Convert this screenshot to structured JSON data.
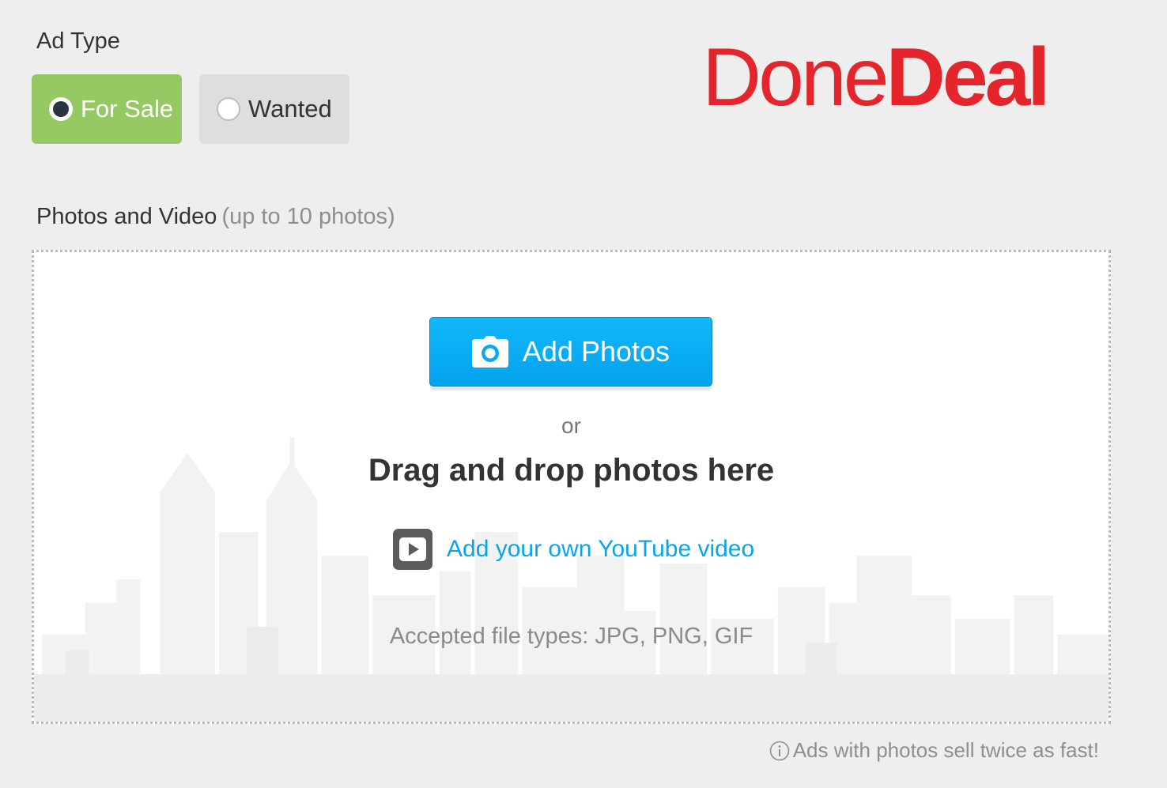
{
  "ad_type": {
    "label": "Ad Type",
    "options": [
      {
        "label": "For Sale",
        "selected": true
      },
      {
        "label": "Wanted",
        "selected": false
      }
    ],
    "selected_color": "#96c963"
  },
  "logo": {
    "part1": "Done",
    "part2": "Deal",
    "color": "#e4252b"
  },
  "photos_section": {
    "heading": "Photos and Video",
    "note": "(up to 10 photos)"
  },
  "dropzone": {
    "add_photos_label": "Add Photos",
    "add_photos_icon": "camera-icon",
    "or_text": "or",
    "drag_text": "Drag and drop photos here",
    "youtube_label": "Add your own YouTube video",
    "youtube_icon": "play-video-icon",
    "accepted_types": "Accepted file types: JPG, PNG, GIF",
    "button_color": "#03a2ee",
    "link_color": "#05a6ec"
  },
  "tip": {
    "icon": "info-icon",
    "text": "Ads with photos sell twice as fast!"
  }
}
